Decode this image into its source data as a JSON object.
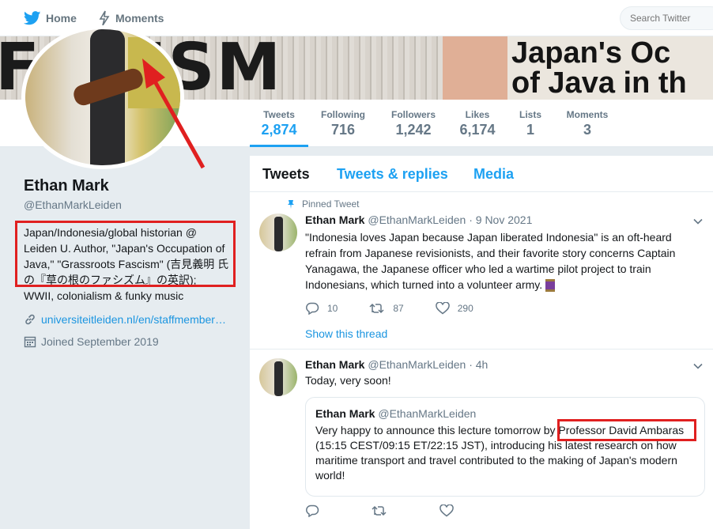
{
  "nav": {
    "home": "Home",
    "moments": "Moments",
    "search_placeholder": "Search Twitter"
  },
  "banner": {
    "left_text": "F",
    "middle_text": "ISM",
    "title_line1": "Japan's Oc",
    "title_line2": "of Java in th"
  },
  "stats": [
    {
      "label": "Tweets",
      "value": "2,874"
    },
    {
      "label": "Following",
      "value": "716"
    },
    {
      "label": "Followers",
      "value": "1,242"
    },
    {
      "label": "Likes",
      "value": "6,174"
    },
    {
      "label": "Lists",
      "value": "1"
    },
    {
      "label": "Moments",
      "value": "3"
    }
  ],
  "profile": {
    "name": "Ethan Mark",
    "handle": "@EthanMarkLeiden",
    "bio_line1": "Japan/Indonesia/global historian @",
    "bio_line2": "Leiden U. Author, \"Japan's Occupation of",
    "bio_line3": "Java,\" \"Grassroots Fascism\" (吉見義明 氏",
    "bio_line4": "の『草の根のファシズム』の英訳);",
    "bio_line5": "WWII, colonialism & funky music",
    "link": "universiteitleiden.nl/en/staffmember…",
    "joined": "Joined September 2019"
  },
  "tabs": {
    "tweets": "Tweets",
    "replies": "Tweets & replies",
    "media": "Media"
  },
  "tweets": [
    {
      "pinned_label": "Pinned Tweet",
      "name": "Ethan Mark",
      "handle": "@EthanMarkLeiden",
      "sep": "·",
      "time": "9 Nov 2021",
      "text_line1": "\"Indonesia loves Japan because Japan liberated Indonesia\" is an oft-heard",
      "text_line2": "refrain from Japanese revisionists, and their favorite story concerns Captain",
      "text_line3": "Yanagawa, the Japanese officer who led a wartime pilot project to train",
      "text_line4": "Indonesians, which turned into a volunteer army.",
      "replies": "10",
      "retweets": "87",
      "likes": "290",
      "show_thread": "Show this thread"
    },
    {
      "name": "Ethan Mark",
      "handle": "@EthanMarkLeiden",
      "sep": "·",
      "time": "4h",
      "text": "Today, very soon!",
      "quote": {
        "name": "Ethan Mark",
        "handle": "@EthanMarkLeiden",
        "line1_a": "Very happy to announce this lecture tomorrow  by ",
        "line1_b": "Professor David Ambaras",
        "line2": "(15:15 CEST/09:15 ET/22:15 JST), introducing his latest research on how",
        "line3": "maritime transport and travel contributed to the making of Japan's modern",
        "line4": "world!"
      }
    }
  ],
  "colors": {
    "accent": "#1da1f2",
    "annotation": "#e02020"
  }
}
